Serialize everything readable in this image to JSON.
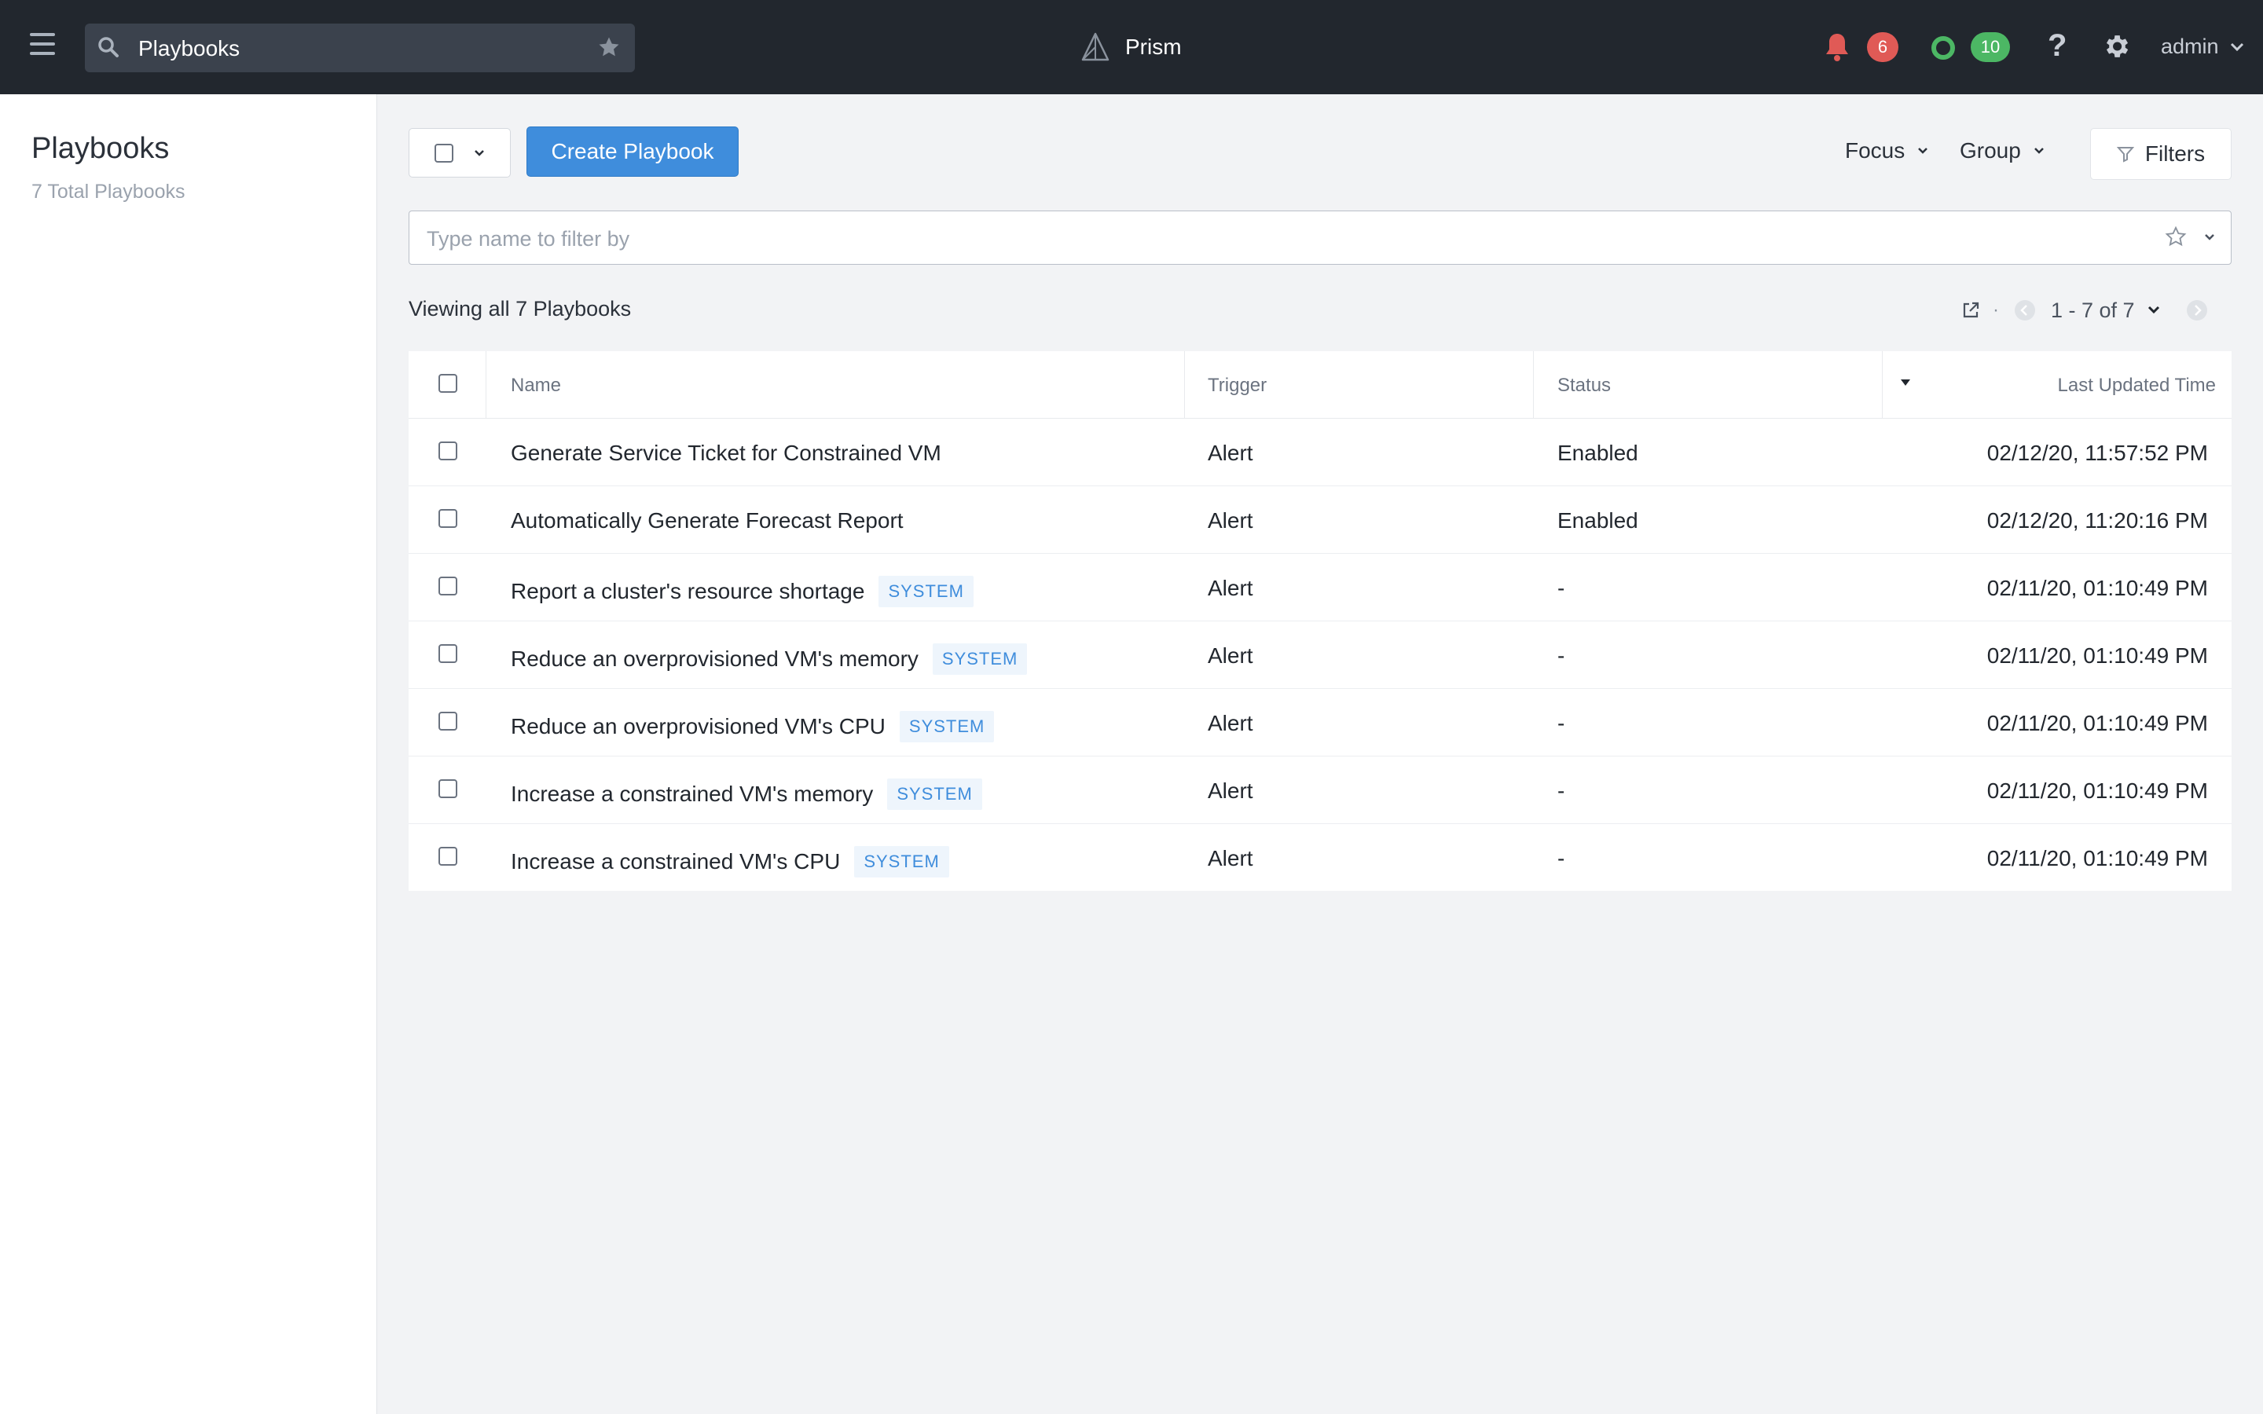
{
  "topbar": {
    "search_value": "Playbooks",
    "brand": "Prism",
    "alert_count": "6",
    "task_count": "10",
    "help": "?",
    "user": "admin"
  },
  "sidebar": {
    "title": "Playbooks",
    "subtitle": "7 Total Playbooks"
  },
  "toolbar": {
    "create_label": "Create Playbook",
    "focus_label": "Focus",
    "group_label": "Group",
    "filters_label": "Filters",
    "filter_placeholder": "Type name to filter by"
  },
  "list": {
    "viewing": "Viewing all 7 Playbooks",
    "pager_dot": "·",
    "pager_range": "1 - 7 of 7",
    "columns": [
      "Name",
      "Trigger",
      "Status",
      "Last Updated Time"
    ],
    "rows": [
      {
        "name": "Generate Service Ticket for Constrained VM",
        "tag": "",
        "trigger": "Alert",
        "status": "Enabled",
        "updated": "02/12/20, 11:57:52 PM"
      },
      {
        "name": "Automatically Generate Forecast Report",
        "tag": "",
        "trigger": "Alert",
        "status": "Enabled",
        "updated": "02/12/20, 11:20:16 PM"
      },
      {
        "name": "Report a cluster's resource shortage",
        "tag": "SYSTEM",
        "trigger": "Alert",
        "status": "-",
        "updated": "02/11/20, 01:10:49 PM"
      },
      {
        "name": "Reduce an overprovisioned VM's memory",
        "tag": "SYSTEM",
        "trigger": "Alert",
        "status": "-",
        "updated": "02/11/20, 01:10:49 PM"
      },
      {
        "name": "Reduce an overprovisioned VM's CPU",
        "tag": "SYSTEM",
        "trigger": "Alert",
        "status": "-",
        "updated": "02/11/20, 01:10:49 PM"
      },
      {
        "name": "Increase a constrained VM's memory",
        "tag": "SYSTEM",
        "trigger": "Alert",
        "status": "-",
        "updated": "02/11/20, 01:10:49 PM"
      },
      {
        "name": "Increase a constrained VM's CPU",
        "tag": "SYSTEM",
        "trigger": "Alert",
        "status": "-",
        "updated": "02/11/20, 01:10:49 PM"
      }
    ]
  },
  "icons": {
    "menu": "hamburger-icon",
    "search": "search-icon",
    "star": "star-icon",
    "brand": "prism-logo-icon",
    "alerts": "bell-icon",
    "tasks": "task-ring-icon",
    "settings": "gear-icon",
    "filter": "funnel-icon",
    "export": "external-link-icon"
  },
  "colors": {
    "topbar": "#22272e",
    "accent": "#3f8ddc",
    "alert_badge": "#e05a56",
    "task_badge": "#4cb764",
    "system_tag_bg": "#eef5fc"
  }
}
